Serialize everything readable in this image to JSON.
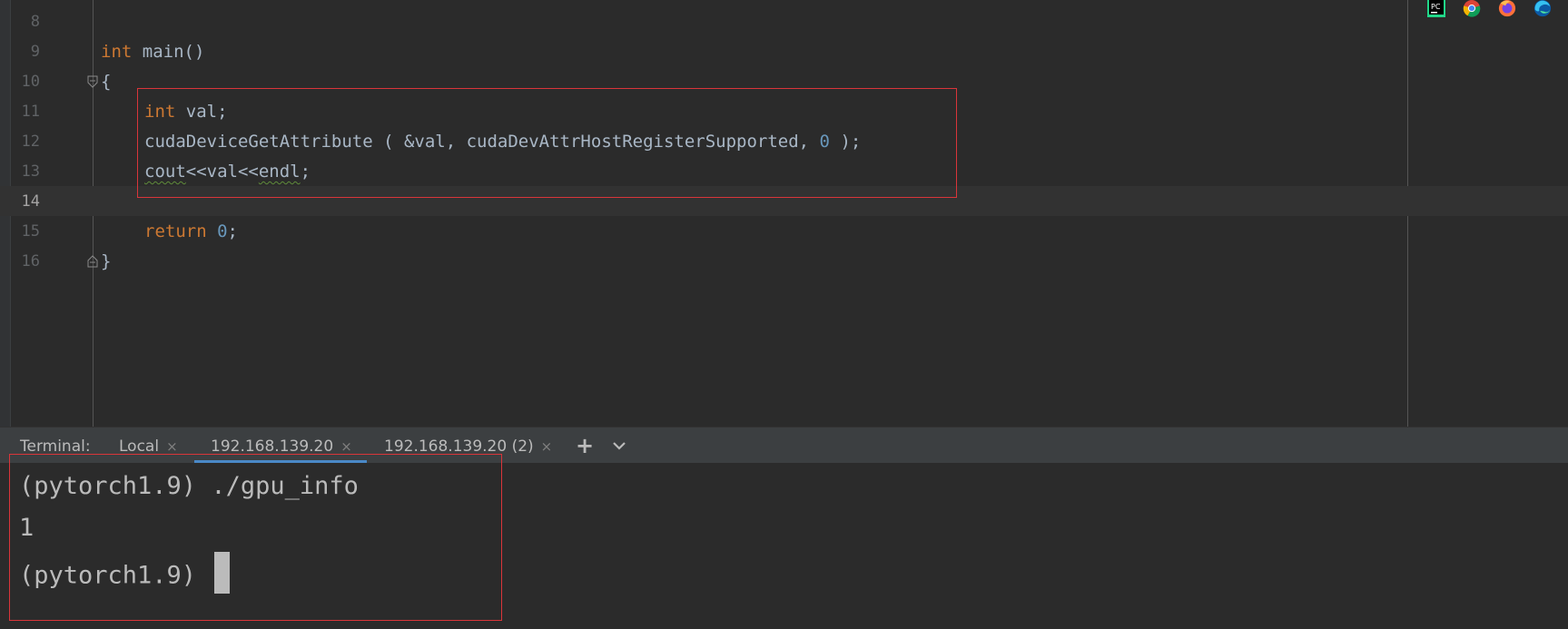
{
  "editor": {
    "lines": [
      {
        "num": "8"
      },
      {
        "num": "9",
        "t1": "int",
        "t2": " main()"
      },
      {
        "num": "10",
        "t1": "{"
      },
      {
        "num": "11",
        "t1": "int",
        "t2": " val;"
      },
      {
        "num": "12",
        "t1": "cudaDeviceGetAttribute ( &val, cudaDevAttrHostRegisterSupported, ",
        "t2": "0",
        "t3": " );"
      },
      {
        "num": "13",
        "t1": "cout",
        "t2": "<<val<<",
        "t3": "endl",
        "t4": ";"
      },
      {
        "num": "14"
      },
      {
        "num": "15",
        "t1": "return",
        "t2": " ",
        "t3": "0",
        "t4": ";"
      },
      {
        "num": "16",
        "t1": "}"
      }
    ]
  },
  "system_icons": [
    "pycharm-icon",
    "chrome-icon",
    "firefox-icon",
    "edge-icon"
  ],
  "terminal": {
    "label": "Terminal:",
    "tabs": [
      {
        "label": "Local",
        "close": "×"
      },
      {
        "label": "192.168.139.20",
        "close": "×",
        "active": true
      },
      {
        "label": "192.168.139.20 (2)",
        "close": "×"
      }
    ],
    "new_tab": "+",
    "lines": [
      "(pytorch1.9) ./gpu_info",
      "1",
      "(pytorch1.9) "
    ]
  },
  "colors": {
    "keyword": "#cc7832",
    "number": "#6897bb",
    "text": "#a9b7c6",
    "highlight_box": "#d9353a",
    "active_tab": "#4a88c7"
  }
}
